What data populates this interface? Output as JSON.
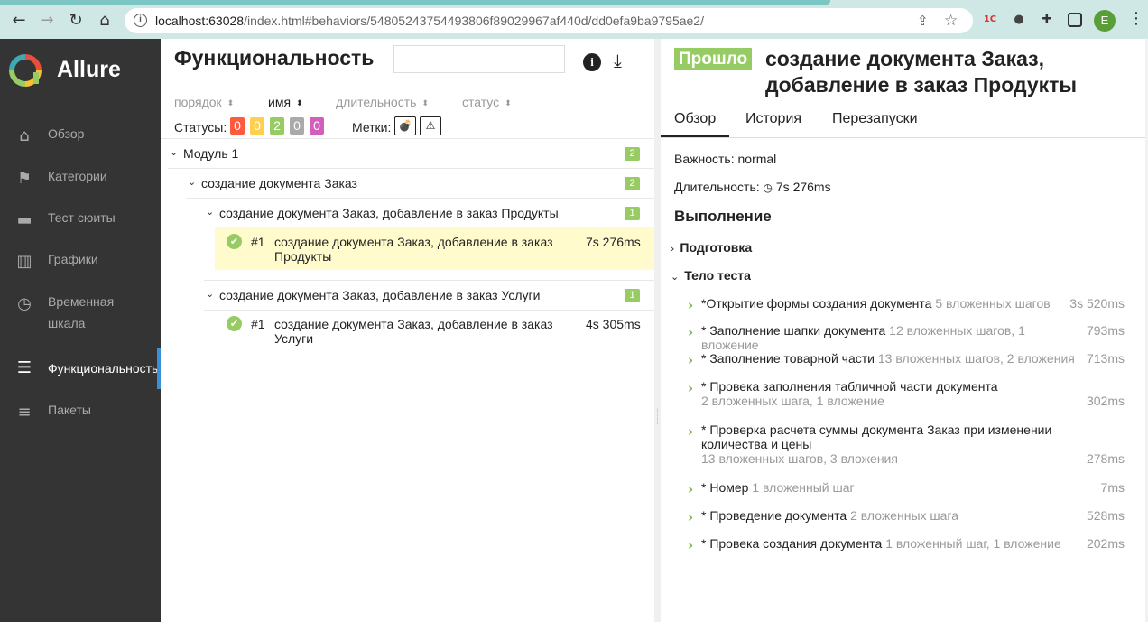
{
  "browser": {
    "url_host": "localhost:63028",
    "url_path": "/index.html#behaviors/54805243754493806f89029967af440d/dd0efa9ba9795ae2/",
    "ext_1c": "1С",
    "avatar_letter": "E"
  },
  "sidebar": {
    "logo": "Allure",
    "items": [
      {
        "label": "Обзор",
        "icon": "home-icon"
      },
      {
        "label": "Категории",
        "icon": "flag-icon"
      },
      {
        "label": "Тест сюиты",
        "icon": "briefcase-icon"
      },
      {
        "label": "Графики",
        "icon": "bar-chart-icon"
      },
      {
        "label": "Временная шкала",
        "label_l1": "Временная",
        "label_l2": "шкала",
        "icon": "clock-icon"
      },
      {
        "label": "Функциональность",
        "icon": "list-icon",
        "active": true
      },
      {
        "label": "Пакеты",
        "icon": "packages-icon"
      }
    ]
  },
  "middle": {
    "title": "Функциональность",
    "sort": [
      "порядок",
      "имя",
      "длительность",
      "статус"
    ],
    "statuses_label": "Статусы:",
    "statuses": [
      {
        "value": "0",
        "color": "#fd5a3e"
      },
      {
        "value": "0",
        "color": "#ffd050"
      },
      {
        "value": "2",
        "color": "#97cc64"
      },
      {
        "value": "0",
        "color": "#aaaaaa"
      },
      {
        "value": "0",
        "color": "#d35ebe"
      }
    ],
    "labels_label": "Метки:",
    "tree": {
      "module": {
        "name": "Модуль 1",
        "count": "2"
      },
      "feature": {
        "name": "создание документа Заказ",
        "count": "2"
      },
      "story1": {
        "name": "создание документа Заказ, добавление в заказ Продукты",
        "count": "1"
      },
      "case1": {
        "num": "#1",
        "name_l1": "создание документа Заказ, добавление в заказ",
        "name_l2": "Продукты",
        "duration": "7s 276ms"
      },
      "story2": {
        "name": "создание документа Заказ, добавление в заказ Услуги",
        "count": "1"
      },
      "case2": {
        "num": "#1",
        "name_l1": "создание документа Заказ, добавление в заказ",
        "name_l2": "Услуги",
        "duration": "4s 305ms"
      }
    }
  },
  "right": {
    "status": "Прошло",
    "title_l1": "создание документа Заказ,",
    "title_l2": "добавление в заказ Продукты",
    "tabs": [
      "Обзор",
      "История",
      "Перезапуски"
    ],
    "severity": "Важность: normal",
    "duration_label": "Длительность:",
    "duration": "7s 276ms",
    "execution": "Выполнение",
    "setup": "Подготовка",
    "body": "Тело теста",
    "steps": [
      {
        "name": "*Открытие формы создания документа",
        "sub": "5 вложенных шагов",
        "duration": "3s 520ms"
      },
      {
        "name": "* Заполнение шапки документа",
        "sub": "12 вложенных шагов, 1 вложение",
        "duration": "793ms"
      },
      {
        "name": "* Заполнение товарной части",
        "sub": "13 вложенных шагов, 2 вложения",
        "duration": "713ms"
      },
      {
        "name": "* Провека заполнения табличной части документа",
        "sub": "2 вложенных шага, 1 вложение",
        "duration": "302ms"
      },
      {
        "name_l1": "* Проверка расчета суммы документа Заказ при изменении",
        "name_l2": "количества и цены",
        "sub": "13 вложенных шагов, 3 вложения",
        "duration": "278ms"
      },
      {
        "name": "* Номер",
        "sub": "1 вложенный шаг",
        "duration": "7ms"
      },
      {
        "name": "* Проведение документа",
        "sub": "2 вложенных шага",
        "duration": "528ms"
      },
      {
        "name": "* Провека создания документа",
        "sub": "1 вложенный шаг, 1 вложение",
        "duration": "202ms"
      }
    ]
  }
}
